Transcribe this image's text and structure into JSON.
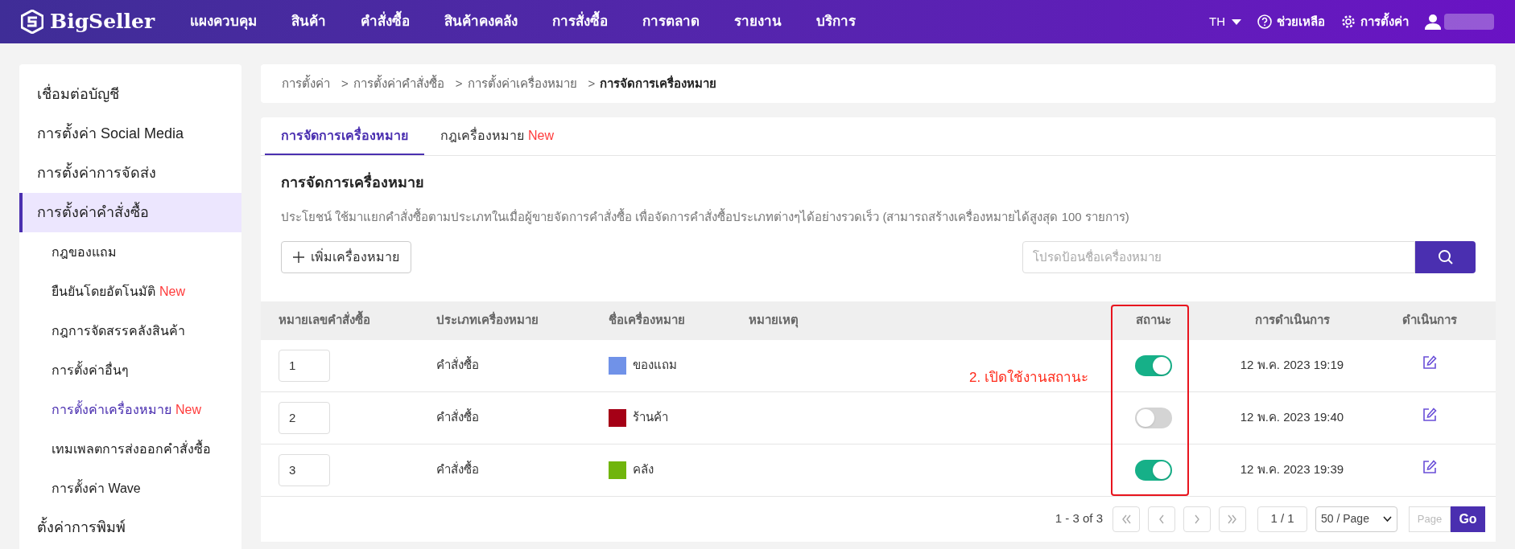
{
  "topbar": {
    "logo": "BigSeller",
    "nav": [
      "แผงควบคุม",
      "สินค้า",
      "คำสั่งซื้อ",
      "สินค้าคงคลัง",
      "การสั่งซื้อ",
      "การตลาด",
      "รายงาน",
      "บริการ"
    ],
    "language": "TH",
    "help": "ช่วยเหลือ",
    "settings": "การตั้งค่า"
  },
  "sidebar": {
    "items": [
      {
        "label": "เชื่อมต่อบัญชี",
        "selected": false
      },
      {
        "label": "การตั้งค่า Social Media",
        "selected": false
      },
      {
        "label": "การตั้งค่าการจัดส่ง",
        "selected": false
      },
      {
        "label": "การตั้งค่าคำสั่งซื้อ",
        "selected": true,
        "children": [
          {
            "label": "กฎของแถม",
            "selected": false
          },
          {
            "label": "ยืนยันโดยอัตโนมัติ",
            "badge": "New",
            "selected": false
          },
          {
            "label": "กฎการจัดสรรคลังสินค้า",
            "selected": false
          },
          {
            "label": "การตั้งค่าอื่นๆ",
            "selected": false
          },
          {
            "label": "การตั้งค่าเครื่องหมาย",
            "badge": "New",
            "selected": true
          },
          {
            "label": "เทมเพลตการส่งออกคำสั่งซื้อ",
            "selected": false
          },
          {
            "label": "การตั้งค่า Wave",
            "selected": false
          }
        ]
      },
      {
        "label": "ตั้งค่าการพิมพ์",
        "selected": false
      }
    ]
  },
  "breadcrumb": [
    {
      "label": "การตั้งค่า"
    },
    {
      "separator": ">",
      "label": "การตั้งค่าคำสั่งซื้อ"
    },
    {
      "separator": ">",
      "label": "การตั้งค่าเครื่องหมาย"
    },
    {
      "separator": ">",
      "label": "การจัดการเครื่องหมาย"
    }
  ],
  "tabs": [
    {
      "label": "การจัดการเครื่องหมาย",
      "selected": true
    },
    {
      "label": "กฎเครื่องหมาย",
      "badge": "New",
      "selected": false
    }
  ],
  "section": {
    "title": "การจัดการเครื่องหมาย",
    "description": "ประโยชน์ ใช้มาแยกคำสั่งซื้อตามประเภทในเมื่อผู้ขายจัดการคำสั่งซื้อ เพื่อจัดการคำสั่งซื้อประเภทต่างๆได้อย่างรวดเร็ว (สามารถสร้างเครื่องหมายได้สูงสุด 100 รายการ)",
    "add_button": "เพิ่มเครื่องหมาย",
    "search": {
      "placeholder": "โปรดป้อนชื่อเครื่องหมาย"
    }
  },
  "table": {
    "columns": [
      "หมายเลขคำสั่งซื้อ",
      "ประเภทเครื่องหมาย",
      "ชื่อเครื่องหมาย",
      "หมายเหตุ",
      "สถานะ",
      "การดำเนินการ",
      "ดำเนินการ"
    ],
    "rows": [
      {
        "order": "1",
        "type": "คำสั่งซื้อ",
        "name": "ของแถม",
        "color": "#7092e8",
        "on": true,
        "time": "12 พ.ค. 2023 19:19"
      },
      {
        "order": "2",
        "type": "คำสั่งซื้อ",
        "name": "ร้านค้า",
        "color": "#a50016",
        "on": false,
        "time": "12 พ.ค. 2023 19:40"
      },
      {
        "order": "3",
        "type": "คำสั่งซื้อ",
        "name": "คลัง",
        "color": "#70b50c",
        "on": true,
        "time": "12 พ.ค. 2023 19:39"
      }
    ]
  },
  "annotation": "2. เปิดใช้งานสถานะ",
  "pagination": {
    "summary": "1 - 3 of 3",
    "page": "1 / 1",
    "page_size": "50 / Page",
    "page_placeholder": "Page",
    "go": "Go"
  }
}
